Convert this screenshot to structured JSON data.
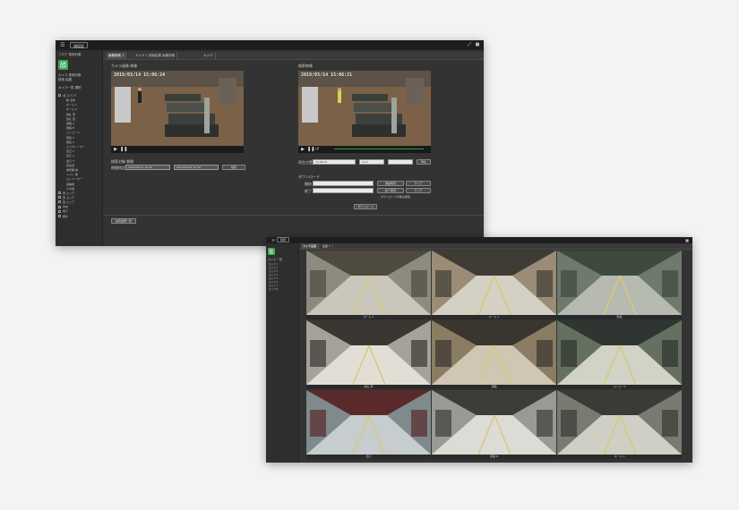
{
  "window1": {
    "app_tab": "顔認証",
    "sidebar_section1": "フロア 検索対象",
    "sidebar_logo_text": "顔",
    "sidebar_info1": "カメラ 検索対象",
    "sidebar_info2": "検索 結果",
    "sidebar_section2": "カメラ一覧 選択",
    "content_tabs": [
      "画像検索 1",
      "カメラ 1 検索結果 画像詳細",
      "カメラ"
    ],
    "left_video_label": "カメラ画像 映像",
    "right_video_label": "検索映像",
    "left_timestamp": "2019/03/14 15:06:24",
    "right_timestamp": "2019/03/14 15:06:21",
    "search_section_label": "検索対象 期間",
    "period_label": "期間指定",
    "period_start": "2019/03/14 15:00",
    "period_end": "2019/03/14 15:30",
    "search_button": "検索",
    "playback_label": "再生位置",
    "playback_time": "15:06:21",
    "speed_value": "x1.0",
    "play_button": "再生",
    "download_section_label": "ダウンロード",
    "start_label": "開始",
    "end_label": "終了",
    "dl_buttons": [
      "開始時刻",
      "クリア",
      "終了時刻",
      "クリア"
    ],
    "dl_note": "ダウンロード可能な時間",
    "download_button": "ダウンロード",
    "bottom_button": "検索結果一覧",
    "tree_items": [
      "駅 全体",
      "ホーム 1",
      "ホーム 2",
      "改札 東",
      "改札 西",
      "通路 A",
      "通路 B",
      "コンコース",
      "階段 1",
      "階段 2",
      "エスカレーター",
      "出口 1",
      "出口 2",
      "出口 3",
      "待合室",
      "券売機 前",
      "トイレ 前",
      "エレベーター",
      "駐輪場",
      "その他"
    ],
    "tree_groups": [
      "北 エリア",
      "南 エリア",
      "東 エリア",
      "西 エリア",
      "中央",
      "地下",
      "屋外"
    ]
  },
  "window2": {
    "app_tab": "監視",
    "sidebar_logo_text": "監",
    "sidebar_label": "カメラ 一覧",
    "content_tabs": [
      "マルチ画面",
      "画面 2"
    ],
    "camera_labels": [
      "ホーム 1",
      "ホーム 2",
      "階段",
      "改札 東",
      "通路",
      "コンコース",
      "出口",
      "通路 B",
      "ホーム 3"
    ],
    "sidebar_items": [
      "カメラ 1",
      "カメラ 2",
      "カメラ 3",
      "カメラ 4",
      "カメラ 5",
      "カメラ 6",
      "カメラ 7",
      "カメラ 8"
    ]
  }
}
